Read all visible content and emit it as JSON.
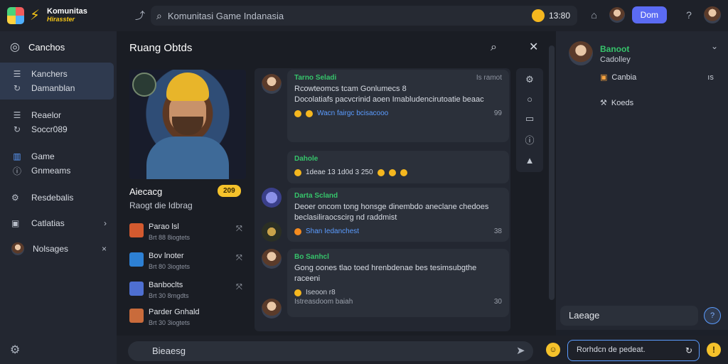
{
  "app": {
    "brand_line1": "Komunitas",
    "brand_line2": "Hirasster"
  },
  "topbar": {
    "search_placeholder": "Komunitasi Game Indanasia",
    "coins": "13:80",
    "primary_button": "Dom"
  },
  "sidebar": {
    "header": "Canchos",
    "items": [
      {
        "line1": "Kanchers",
        "line2": "Damanblan"
      },
      {
        "line1": "Reaelor",
        "line2": "Soccr089"
      },
      {
        "line1": "Game",
        "line2": "Gnmeams"
      }
    ],
    "singles": [
      {
        "label": "Resdebalis",
        "trail": ""
      },
      {
        "label": "Catlatias",
        "trail": "›"
      },
      {
        "label": "Nolsages",
        "trail": "×"
      }
    ]
  },
  "main": {
    "title": "Ruang Obtds",
    "info_title": "Aiecacg",
    "info_badge": "209",
    "info_sub": "Raogt die Idbrag",
    "list": [
      {
        "title": "Parao lsl",
        "sub": "Brt 88 8iogtets",
        "action": "⤧",
        "color": "#d35a2f"
      },
      {
        "title": "Bov lnoter",
        "sub": "Brt 80 3iogtets",
        "action": "⤧",
        "color": "#2d80d4"
      },
      {
        "title": "Banboclts",
        "sub": "Brt 30 8rngdts",
        "action": "⤧",
        "color": "#4e6fd1"
      },
      {
        "title": "Parder Gnhald",
        "sub": "Brt 30 3iogtets",
        "action": "",
        "color": "#c96b3b"
      }
    ]
  },
  "messages": [
    {
      "name": "Tarno Seladi",
      "meta": "Is ramot",
      "body": "Rcowteomcs tcam Gonlumecs  8\nDocolatiafs pacvcrinid aoen Imabludencirutoatie beaac",
      "foot_link": "Wacn fairgc bcisacooo",
      "foot_num": "99"
    },
    {
      "name": "Dahole",
      "reactions": "1deae  13  1d0d 3  250"
    },
    {
      "name": "Darta Scland",
      "body": "Deoer oncom tong honsge dinembdo aneclane chedoes\nbeclasiliraocscirg  nd raddmist",
      "foot_link": "Shan Iedanchest",
      "foot_num": "38"
    },
    {
      "name": "Bo Sanhcl",
      "body": "Gong oones tlao toed hrenbdenae bes tesimsubgthe\nraceeni",
      "foot_text": "Iseoon  r8",
      "foot_sub": "Istreasdoom baiah",
      "foot_num": "30"
    }
  ],
  "rightpanel": {
    "name": "Banoot",
    "sub": "Cadolley",
    "rows": [
      {
        "label": "Canbia",
        "trail": "ıs"
      },
      {
        "label": "Koeds",
        "trail": ""
      }
    ],
    "lang": "Laeage"
  },
  "bottombar": {
    "composer": "Bieaesg",
    "reply": "Rorhdcn de pedeat."
  }
}
